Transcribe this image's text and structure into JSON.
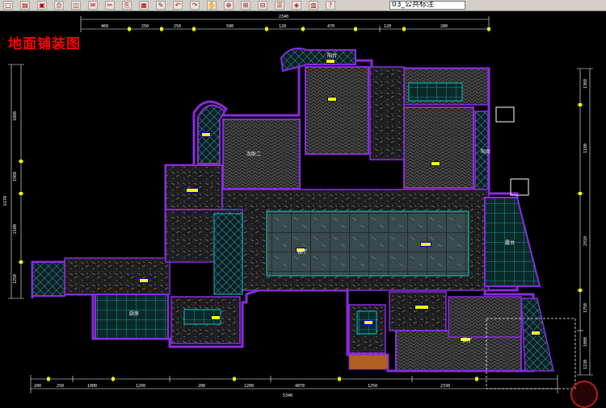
{
  "toolbar": {
    "layer_name": "03_公共标注",
    "icons": [
      "new-icon",
      "open-icon",
      "save-icon",
      "print-icon",
      "preview-icon",
      "publish-icon",
      "cut-icon",
      "copy-icon",
      "paste-icon",
      "match-icon",
      "undo-icon",
      "redo-icon",
      "pan-icon",
      "zoom-icon",
      "zoom-window-icon",
      "zoom-previous-icon",
      "properties-icon",
      "design-center-icon",
      "tool-palette-icon",
      "help-icon"
    ]
  },
  "drawing": {
    "title": "地面铺装图",
    "dims_top": {
      "overall": "2340",
      "segments": [
        "460",
        "250",
        "250",
        "500",
        "120",
        "470",
        "120",
        "280"
      ]
    },
    "dims_bottom": {
      "overall": "5340",
      "segments": [
        "200",
        "250",
        "1000",
        "1200",
        "200",
        "2200",
        "4070",
        "1250",
        "2330"
      ]
    },
    "dims_left": [
      "6170",
      "1080",
      "1960",
      "2100",
      "1250"
    ],
    "dims_right": [
      "1360",
      "1180",
      "2910",
      "1750",
      "1000",
      "1230"
    ]
  },
  "rooms": [
    {
      "id": "r1",
      "label": ""
    },
    {
      "id": "r2",
      "label": ""
    },
    {
      "id": "r3",
      "label": ""
    },
    {
      "id": "r4",
      "label": "次卧二"
    },
    {
      "id": "r5",
      "label": "阳台"
    },
    {
      "id": "r6",
      "label": ""
    },
    {
      "id": "r7",
      "label": "阳台"
    },
    {
      "id": "r8",
      "label": "客厅"
    },
    {
      "id": "r9",
      "label": ""
    },
    {
      "id": "r10",
      "label": "厨房"
    },
    {
      "id": "r11",
      "label": ""
    },
    {
      "id": "r12",
      "label": "露台"
    },
    {
      "id": "r13",
      "label": "餐厅"
    }
  ],
  "colors": {
    "wall": "#8a2be2",
    "floor_grid": "#00c8c8",
    "dimension": "#ffffff",
    "dim_tick": "#ffff00",
    "title": "#ff0000",
    "room_tag": "#ffff00"
  }
}
